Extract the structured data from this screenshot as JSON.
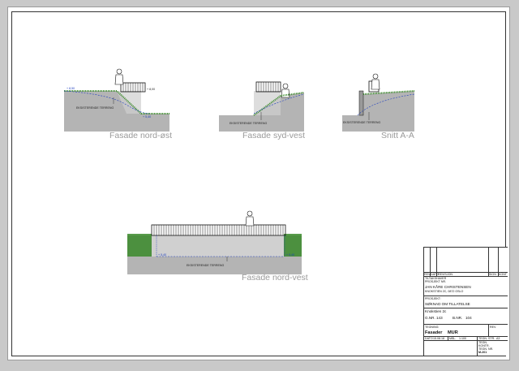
{
  "views": {
    "nord_ost": {
      "caption": "Fasade nord-øst",
      "label_terrain": "EKSISTERENDE TERRENG",
      "level_left": "+ 8,50",
      "level_right": "+ 8,00",
      "level_bottom": "+ 5,40"
    },
    "syd_vest": {
      "caption": "Fasade syd-vest",
      "label_terrain": "EKSISTERENDE TERRENG"
    },
    "snitt": {
      "caption": "Snitt A-A",
      "label_terrain": "EKSISTERENDE TERRENG"
    },
    "nord_vest": {
      "caption": "Fasade nord-vest",
      "label_terrain": "EKSISTERENDE TERRENG",
      "level_left": "+ 5,40",
      "level_right": "+ 5,40"
    }
  },
  "title_block": {
    "rev_header": [
      "REV.",
      "DATO",
      "REVISJON",
      "SIGN",
      "KONT"
    ],
    "tiltakshaver_label": "TILTAKSHAVER",
    "prosjekt_label": "PROSJEKT NR.",
    "owner_name": "JAN KÅRE CHRISTENSEN",
    "owner_address": "KNOKSTIEN 2C, 0872 OSLO",
    "prosjekt_header": "PROSJEKT:",
    "prosjekt_name": "SØKNAD OM TILLATELSE",
    "address_line": "Knokstien 2c",
    "gnr_label": "G.NR.",
    "gnr_value": "143",
    "bnr_label": "B.NR.",
    "bnr_value": "104",
    "tegning_label": "TEGNING:",
    "rev_label": "REV.",
    "drawing_title_a": "Fasader",
    "drawing_title_b": "MUR",
    "dato_label": "DATO",
    "dato_value": "15.08.18",
    "malestokk_label": "MÅL.",
    "malestokk_value": "1:100",
    "tegn_label": "TEGN. STR.",
    "tegn_value": "A3",
    "tegnet_label": "TEGN.",
    "kontr_label": "KONTR.",
    "tegn_nr_label": "TEGN. NR.",
    "tegn_nr_value": "M-201"
  },
  "colors": {
    "wall": "#c8c8c8",
    "ground": "#b0b0b0",
    "grass": "#3a8a2a",
    "terrain_line": "#1f3fbf",
    "caption": "#9a9a9a"
  }
}
